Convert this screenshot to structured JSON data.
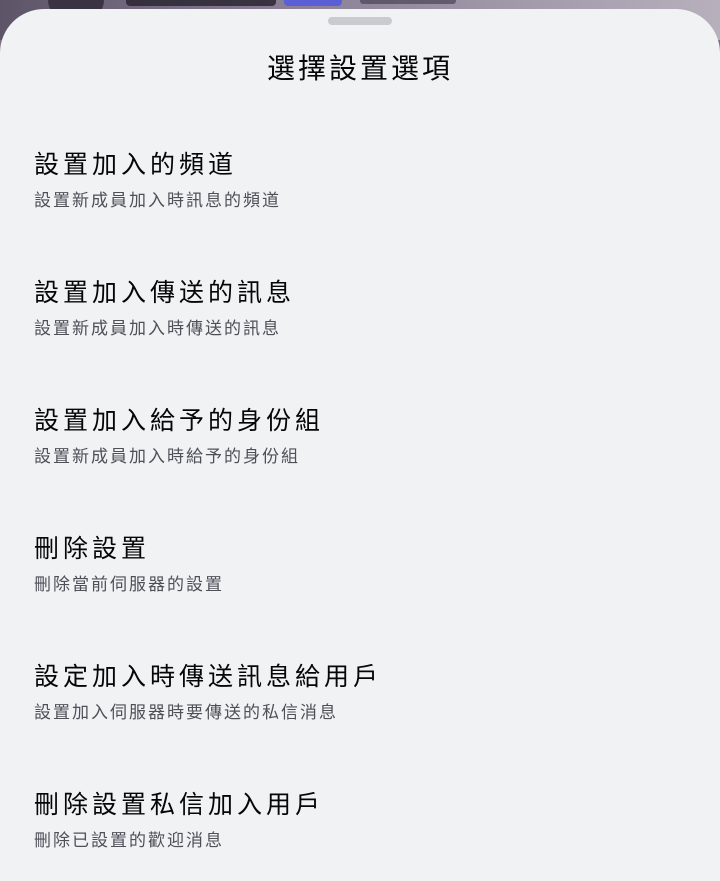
{
  "sheet": {
    "title": "選擇設置選項"
  },
  "options": [
    {
      "title": "設置加入的頻道",
      "description": "設置新成員加入時訊息的頻道"
    },
    {
      "title": "設置加入傳送的訊息",
      "description": "設置新成員加入時傳送的訊息"
    },
    {
      "title": "設置加入給予的身份組",
      "description": "設置新成員加入時給予的身份組"
    },
    {
      "title": "刪除設置",
      "description": "刪除當前伺服器的設置"
    },
    {
      "title": "設定加入時傳送訊息給用戶",
      "description": "設置加入伺服器時要傳送的私信消息"
    },
    {
      "title": "刪除設置私信加入用戶",
      "description": "刪除已設置的歡迎消息"
    }
  ]
}
